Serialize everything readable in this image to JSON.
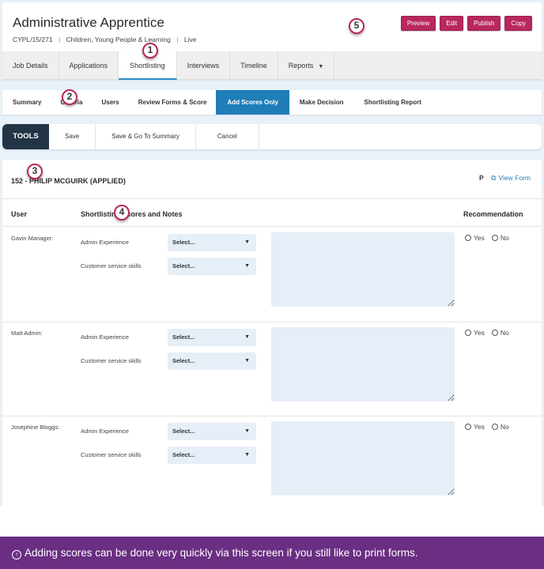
{
  "header": {
    "title": "Administrative Apprentice",
    "reference": "CYPL/15/271",
    "department": "Children, Young People & Learning",
    "status": "Live",
    "separator": "|",
    "actions": [
      {
        "label": "Preview"
      },
      {
        "label": "Edit"
      },
      {
        "label": "Publish"
      },
      {
        "label": "Copy"
      }
    ]
  },
  "main_tabs": [
    {
      "label": "Job Details",
      "active": false
    },
    {
      "label": "Applications",
      "active": false
    },
    {
      "label": "Shortlisting",
      "active": true
    },
    {
      "label": "Interviews",
      "active": false
    },
    {
      "label": "Timeline",
      "active": false
    },
    {
      "label": "Reports",
      "active": false,
      "dropdown": true
    }
  ],
  "sub_tabs": [
    {
      "label": "Summary",
      "active": false
    },
    {
      "label": "Criteria",
      "active": false
    },
    {
      "label": "Users",
      "active": false
    },
    {
      "label": "Review Forms & Score",
      "active": false
    },
    {
      "label": "Add Scores Only",
      "active": true
    },
    {
      "label": "Make Decision",
      "active": false
    },
    {
      "label": "Shortlisting Report",
      "active": false
    }
  ],
  "tools": {
    "label": "TOOLS",
    "buttons": [
      {
        "label": "Save"
      },
      {
        "label": "Save & Go To Summary"
      },
      {
        "label": "Cancel"
      }
    ]
  },
  "applicant": {
    "heading": "152 - PHILIP MCGUIRK (APPLIED)",
    "flag": "P",
    "view_form_label": "View Form"
  },
  "columns": {
    "user": "User",
    "scores": "Shortlisting Scores and Notes",
    "recommendation": "Recommendation"
  },
  "reviewers": [
    {
      "name": "Gavin Manager:",
      "criteria": [
        {
          "label": "Admin Experience",
          "value": "Select..."
        },
        {
          "label": "Customer service skills",
          "value": "Select..."
        }
      ],
      "notes": "",
      "recommendation": {
        "yes": "Yes",
        "no": "No",
        "selected": null
      }
    },
    {
      "name": "Matt Admin:",
      "criteria": [
        {
          "label": "Admin Experience",
          "value": "Select..."
        },
        {
          "label": "Customer service skills",
          "value": "Select..."
        }
      ],
      "notes": "",
      "recommendation": {
        "yes": "Yes",
        "no": "No",
        "selected": null
      }
    },
    {
      "name": "Josephine Bloggs:",
      "criteria": [
        {
          "label": "Admin Experience",
          "value": "Select..."
        },
        {
          "label": "Customer service skills",
          "value": "Select..."
        }
      ],
      "notes": "",
      "recommendation": {
        "yes": "Yes",
        "no": "No",
        "selected": null
      }
    }
  ],
  "markers": [
    "1",
    "2",
    "3",
    "4",
    "5"
  ],
  "caption": {
    "icon": "info-up-arrow-icon",
    "text": "Adding scores can be done very quickly via this screen if you still like to print forms."
  },
  "colors": {
    "accent": "#b8285e",
    "active_tab": "#1f7db8",
    "tools_dark": "#233446",
    "caption_bg": "#6a2e82",
    "input_bg": "#e6eef8"
  }
}
